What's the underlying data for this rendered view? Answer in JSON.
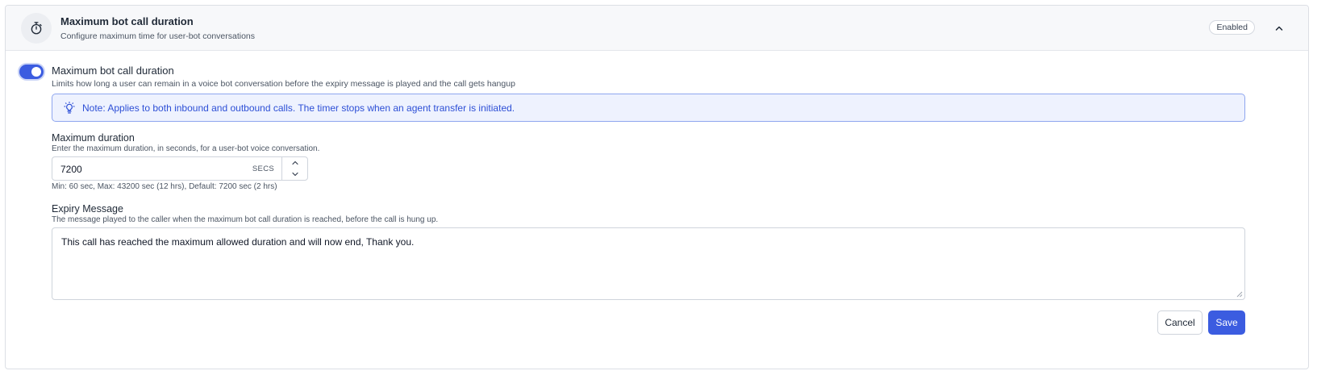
{
  "header": {
    "icon": "stopwatch-icon",
    "title": "Maximum bot call duration",
    "subtitle": "Configure maximum time for user-bot conversations",
    "status": "Enabled",
    "collapse_icon": "chevron-up-icon"
  },
  "setting": {
    "enabled": true,
    "title": "Maximum bot call duration",
    "description": "Limits how long a user can remain in a voice bot conversation before the expiry message is played and the call gets hangup"
  },
  "note": {
    "icon": "lightbulb-icon",
    "text": "Note: Applies to both inbound and outbound calls. The timer stops when an agent transfer is initiated."
  },
  "duration": {
    "label": "Maximum duration",
    "description": "Enter the maximum duration, in seconds, for a user-bot voice conversation.",
    "value": "7200",
    "unit": "SECS",
    "hint": "Min: 60 sec, Max: 43200 sec (12 hrs), Default: 7200 sec (2 hrs)"
  },
  "expiry": {
    "label": "Expiry Message",
    "description": "The message played to the caller when the maximum bot call duration is reached, before the call is hung up.",
    "value": "This call has reached the maximum allowed duration and will now end, Thank you."
  },
  "actions": {
    "cancel_label": "Cancel",
    "save_label": "Save"
  },
  "colors": {
    "accent": "#3b5ce0",
    "note_background": "#eef2fe",
    "note_text": "#2d4fd6"
  }
}
